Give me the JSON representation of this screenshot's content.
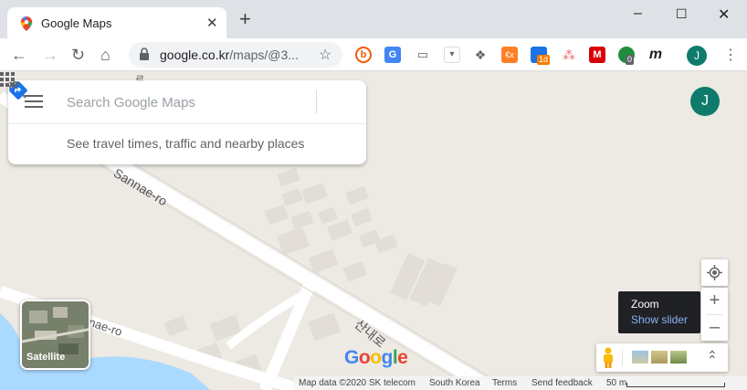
{
  "browser": {
    "tab_title": "Google Maps",
    "new_tab": "+",
    "tab_close": "✕",
    "window_controls": [
      "–",
      "☐",
      "✕"
    ],
    "url_host": "google.co.kr",
    "url_rest": "/maps/@3...",
    "nav": {
      "back": "←",
      "forward": "→",
      "reload": "↻",
      "home": "⌂"
    },
    "extensions": [
      {
        "name": "ext-b",
        "color": "#f25c05",
        "label": "b"
      },
      {
        "name": "ext-translate",
        "color": "#4285f4",
        "label": "G"
      },
      {
        "name": "ext-screenshot",
        "color": "#9aa0a6",
        "label": "▭"
      },
      {
        "name": "ext-dropdown",
        "color": "#bdc1c6",
        "label": "▾"
      },
      {
        "name": "ext-dropbox",
        "color": "#5f6368",
        "label": "❖"
      },
      {
        "name": "ext-exchange",
        "color": "#ff7f27",
        "label": "€x"
      },
      {
        "name": "ext-calendar",
        "color": "#1a73e8",
        "label": "1d"
      },
      {
        "name": "ext-asana",
        "color": "#f06a6a",
        "label": "⁂"
      },
      {
        "name": "ext-mega",
        "color": "#d90007",
        "label": "M"
      },
      {
        "name": "ext-shield",
        "color": "#1e8e3e",
        "label": "0"
      },
      {
        "name": "ext-m",
        "color": "#202124",
        "label": "m"
      }
    ],
    "profile_initial": "J",
    "menu": "⋮"
  },
  "search": {
    "placeholder": "Search Google Maps",
    "travel_text": "See travel times, traffic and nearby places"
  },
  "map": {
    "road_label_1": "Sannae-ro",
    "road_label_2": "nae-ro",
    "road_label_kr": "산내로",
    "road_label_top": "로",
    "profile_initial": "J",
    "satellite_label": "Satellite",
    "zoom_in": "+",
    "zoom_out": "–",
    "tooltip_title": "Zoom",
    "tooltip_sub": "Show slider",
    "expand": "⌃"
  },
  "attribution": {
    "map_data": "Map data ©2020 SK telecom",
    "region": "South Korea",
    "terms": "Terms",
    "feedback": "Send feedback",
    "scale": "50 m"
  },
  "colors": {
    "land": "#ede9e3",
    "road": "#ffffff",
    "building": "#e2ddd7",
    "water": "#aadaff",
    "accent": "#1a73e8"
  }
}
